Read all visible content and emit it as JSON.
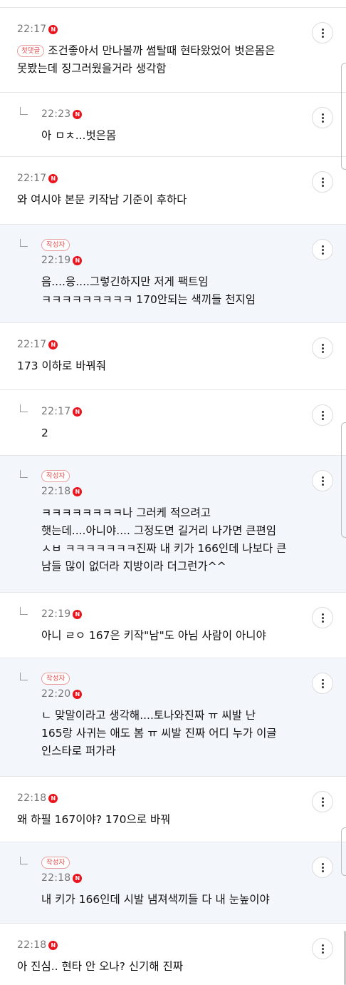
{
  "first_reply_label": "첫댓글",
  "author_label": "작성자",
  "new_badge": "N",
  "comments": [
    {
      "time": "22:17",
      "text": "조건좋아서 만나볼까 썸탈때 현타왔었어 벗은몸은\n못봤는데 징그러웠을거라 생각함",
      "reply": false,
      "author": false,
      "first": true
    },
    {
      "time": "22:23",
      "text": "아 ㅁㅊ...벗은몸",
      "reply": true,
      "author": false,
      "first": false
    },
    {
      "time": "22:17",
      "text": "와 여시야 본문 키작남 기준이 후하다",
      "reply": false,
      "author": false,
      "first": false
    },
    {
      "time": "22:19",
      "text": "음....응....그렇긴하지만 저게 팩트임\nㅋㅋㅋㅋㅋㅋㅋㅋㅋ 170안되는 색끼들 천지임",
      "reply": true,
      "author": true,
      "first": false
    },
    {
      "time": "22:17",
      "text": "173 이하로 바꿔줘",
      "reply": false,
      "author": false,
      "first": false
    },
    {
      "time": "22:17",
      "text": "2",
      "reply": true,
      "author": false,
      "first": false
    },
    {
      "time": "22:18",
      "text": "ㅋㅋㅋㅋㅋㅋㅋㅋ나 그러케 적으려고\n햇는데....아니야.... 그정도면 길거리 나가면 큰편임\nㅅㅂ ㅋㅋㅋㅋㅋㅋㅋ진짜 내 키가 166인데 나보다 큰\n남들 많이 없더라 지방이라 더그런가^^",
      "reply": true,
      "author": true,
      "first": false
    },
    {
      "time": "22:19",
      "text": "아니 ㄹㅇ 167은 키작\"남\"도 아님 사람이 아니야",
      "reply": true,
      "author": false,
      "first": false
    },
    {
      "time": "22:20",
      "text": "ㄴ 맞말이라고 생각해....토나와진짜 ㅠ 씨발 난\n165랑 사귀는 애도 봄 ㅠ 씨발 진짜 어디 누가 이글\n인스타로 퍼가라",
      "reply": true,
      "author": true,
      "first": false
    },
    {
      "time": "22:18",
      "text": "왜 하필 167이야? 170으로 바꿔",
      "reply": false,
      "author": false,
      "first": false
    },
    {
      "time": "22:18",
      "text": "내 키가 166인데 시발 냄져색끼들 다 내 눈높이야",
      "reply": true,
      "author": true,
      "first": false
    },
    {
      "time": "22:18",
      "text": "아 진심.. 현타 안 오나? 신기해 진짜",
      "reply": false,
      "author": false,
      "first": false
    }
  ]
}
